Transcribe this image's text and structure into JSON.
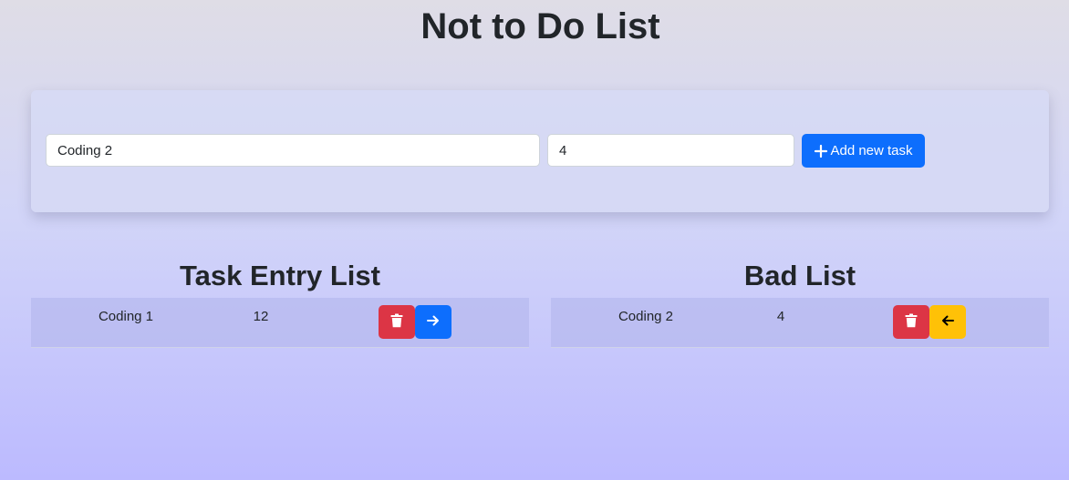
{
  "header": {
    "title": "Not to Do List"
  },
  "form": {
    "task_value": "Coding 2",
    "hours_value": "4",
    "add_button_label": "Add new task"
  },
  "task_entry_list": {
    "title": "Task Entry List",
    "rows": [
      {
        "task": "Coding 1",
        "hours": "12"
      }
    ]
  },
  "bad_list": {
    "title": "Bad List",
    "rows": [
      {
        "task": "Coding 2",
        "hours": "4"
      }
    ]
  },
  "colors": {
    "primary": "#0d6efd",
    "danger": "#dc3545",
    "warning": "#ffc107"
  },
  "icons": {
    "add": "plus-icon",
    "delete": "trash-icon",
    "move_to_bad": "arrow-right-icon",
    "move_to_entry": "arrow-left-icon"
  }
}
